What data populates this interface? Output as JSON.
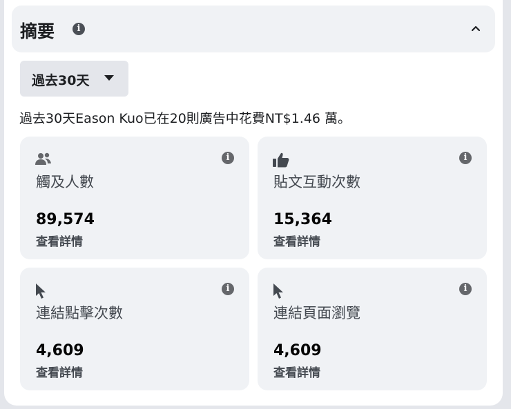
{
  "header": {
    "title": "摘要",
    "info_icon": "info-icon",
    "collapse_icon": "chevron-up-icon"
  },
  "period": {
    "label": "過去30天",
    "icon": "caret-down-icon"
  },
  "summary_text": "過去30天Eason Kuo已在20則廣告中花費NT$1.46 萬。",
  "tiles": [
    {
      "icon": "people-icon",
      "label": "觸及人數",
      "value": "89,574",
      "link": "查看詳情"
    },
    {
      "icon": "thumbs-up-icon",
      "label": "貼文互動次數",
      "value": "15,364",
      "link": "查看詳情"
    },
    {
      "icon": "cursor-icon",
      "label": "連結點擊次數",
      "value": "4,609",
      "link": "查看詳情"
    },
    {
      "icon": "cursor-icon",
      "label": "連結頁面瀏覽",
      "value": "4,609",
      "link": "查看詳情"
    }
  ]
}
